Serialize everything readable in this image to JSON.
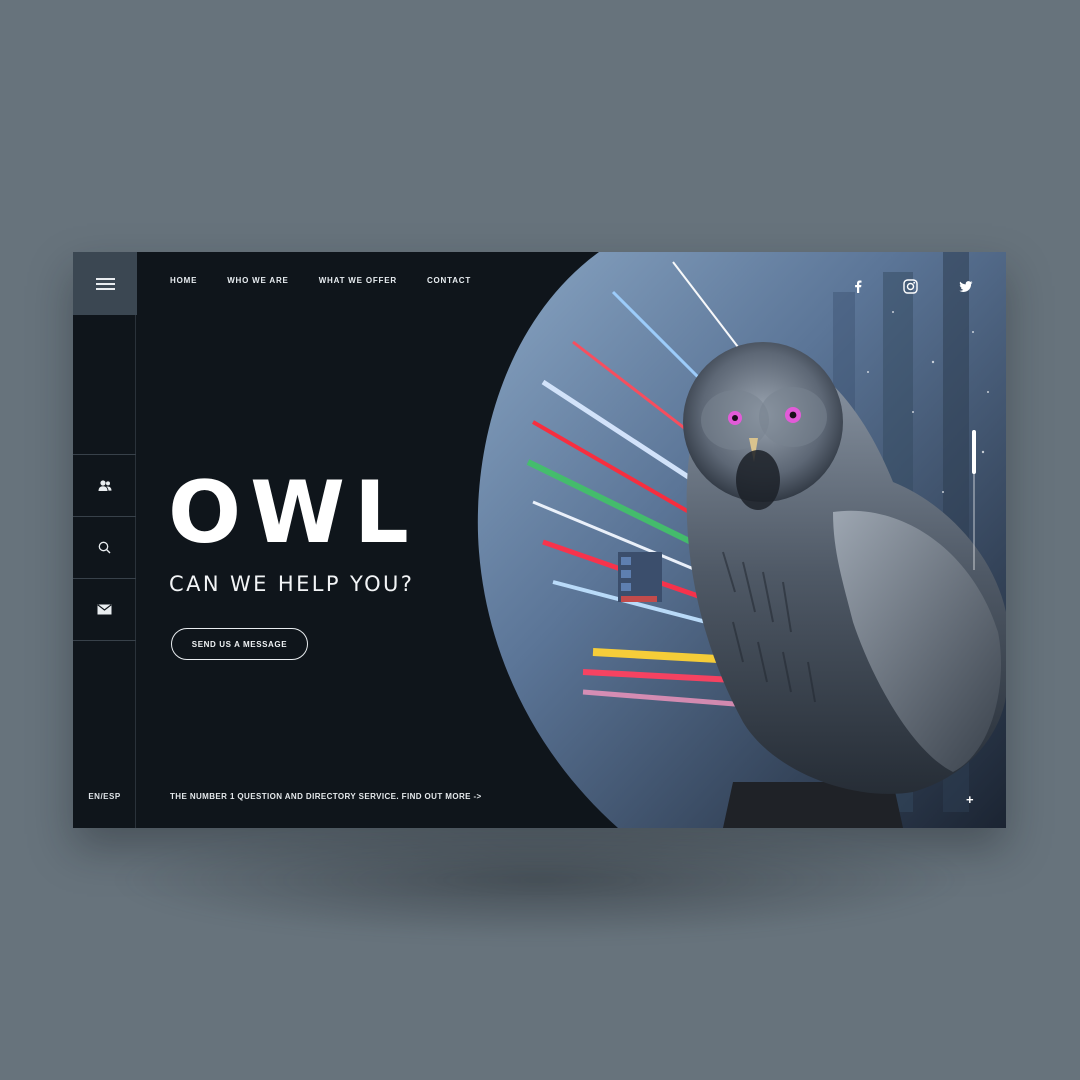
{
  "sidebar": {
    "language": "EN/ESP"
  },
  "nav": {
    "items": [
      "HOME",
      "WHO WE ARE",
      "WHAT WE OFFER",
      "CONTACT"
    ]
  },
  "hero": {
    "title": "OWL",
    "subtitle": "CAN WE HELP YOU?",
    "cta_label": "SEND US A MESSAGE"
  },
  "footer": {
    "tagline": "THE NUMBER 1 QUESTION AND DIRECTORY SERVICE. FIND OUT MORE ->"
  },
  "right_panel": {
    "plus_label": "+"
  },
  "icons": {
    "menu": "hamburger-icon",
    "users": "users-icon",
    "search": "search-icon",
    "mail": "mail-icon",
    "facebook": "facebook-icon",
    "instagram": "instagram-icon",
    "twitter": "twitter-icon"
  },
  "colors": {
    "background": "#67737c",
    "panel": "#0f151b",
    "menu_button": "#3b4752",
    "owl_eye": "#e25bd8"
  }
}
